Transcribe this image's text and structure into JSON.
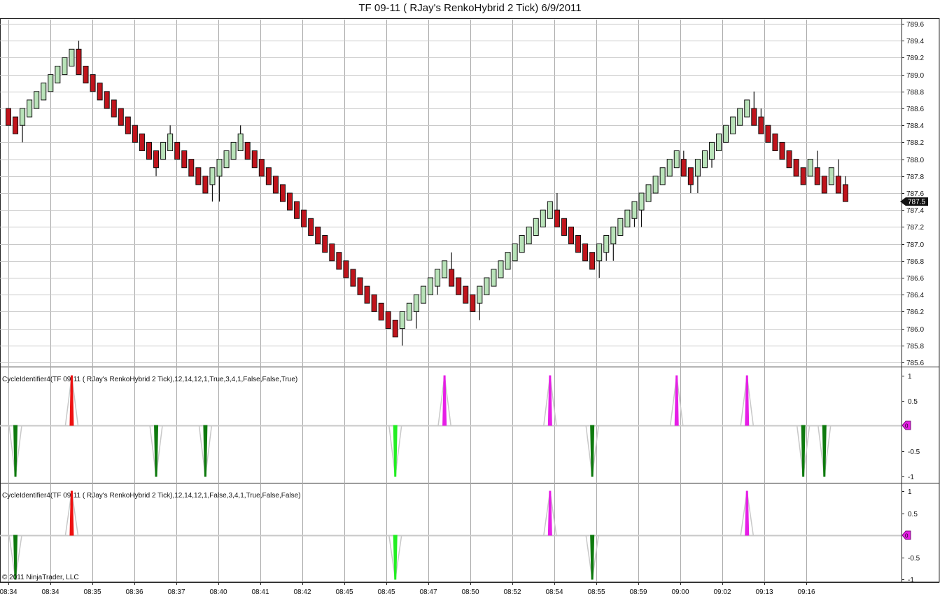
{
  "window": {
    "title": "TF 09-11 ( RJay's RenkoHybrid  2 Tick)  6/9/2011"
  },
  "colors": {
    "up_fill": "#b9e3b9",
    "down_fill": "#c0141c",
    "grid": "#c8c8c8",
    "vgrid": "#a8a8a8",
    "cycle_up": "#ee1111",
    "cycle_up_alt": "#e61ee6",
    "cycle_down": "#0e7a0e",
    "cycle_down_alt": "#22ee22",
    "envelope": "#c8c8c8",
    "zero_badge": "#e61ee6"
  },
  "chart_data": [
    {
      "type": "candlestick",
      "title": "TF 09-11 ( RJay's RenkoHybrid  2 Tick)  6/9/2011",
      "ylim": [
        785.5,
        789.65
      ],
      "y_ticks": [
        "789.6",
        "789.4",
        "789.2",
        "789.0",
        "788.8",
        "788.6",
        "788.4",
        "788.2",
        "788.0",
        "787.8",
        "787.6",
        "787.4",
        "787.2",
        "787.0",
        "786.8",
        "786.6",
        "786.4",
        "786.2",
        "786.0",
        "785.8",
        "785.6"
      ],
      "x_ticks": [
        "08:34",
        "08:34",
        "08:35",
        "08:36",
        "08:37",
        "08:40",
        "08:41",
        "08:42",
        "08:45",
        "08:45",
        "08:47",
        "08:50",
        "08:52",
        "08:54",
        "08:55",
        "08:59",
        "09:00",
        "09:02",
        "09:13",
        "09:16"
      ],
      "last_price": "787.5",
      "bricks": [
        {
          "d": -1,
          "o": 788.6,
          "c": 788.4,
          "lo": 788.4,
          "hi": 788.6
        },
        {
          "d": -1,
          "o": 788.5,
          "c": 788.3,
          "lo": 788.3,
          "hi": 788.5
        },
        {
          "d": 1,
          "o": 788.4,
          "c": 788.6,
          "lo": 788.2,
          "hi": 788.6
        },
        {
          "d": 1,
          "o": 788.5,
          "c": 788.7,
          "lo": 788.5,
          "hi": 788.7
        },
        {
          "d": 1,
          "o": 788.6,
          "c": 788.8,
          "lo": 788.6,
          "hi": 788.8
        },
        {
          "d": 1,
          "o": 788.7,
          "c": 788.9,
          "lo": 788.7,
          "hi": 788.9
        },
        {
          "d": 1,
          "o": 788.8,
          "c": 789.0,
          "lo": 788.8,
          "hi": 789.0
        },
        {
          "d": 1,
          "o": 788.9,
          "c": 789.1,
          "lo": 788.9,
          "hi": 789.1
        },
        {
          "d": 1,
          "o": 789.0,
          "c": 789.2,
          "lo": 789.0,
          "hi": 789.2
        },
        {
          "d": 1,
          "o": 789.1,
          "c": 789.3,
          "lo": 789.1,
          "hi": 789.3
        },
        {
          "d": -1,
          "o": 789.3,
          "c": 789.0,
          "lo": 789.0,
          "hi": 789.4
        },
        {
          "d": -1,
          "o": 789.1,
          "c": 788.9,
          "lo": 788.9,
          "hi": 789.1
        },
        {
          "d": -1,
          "o": 789.0,
          "c": 788.8,
          "lo": 788.8,
          "hi": 789.0
        },
        {
          "d": -1,
          "o": 788.9,
          "c": 788.7,
          "lo": 788.7,
          "hi": 788.9
        },
        {
          "d": -1,
          "o": 788.8,
          "c": 788.6,
          "lo": 788.6,
          "hi": 788.8
        },
        {
          "d": -1,
          "o": 788.7,
          "c": 788.5,
          "lo": 788.5,
          "hi": 788.7
        },
        {
          "d": -1,
          "o": 788.6,
          "c": 788.4,
          "lo": 788.4,
          "hi": 788.6
        },
        {
          "d": -1,
          "o": 788.5,
          "c": 788.3,
          "lo": 788.3,
          "hi": 788.5
        },
        {
          "d": -1,
          "o": 788.4,
          "c": 788.2,
          "lo": 788.2,
          "hi": 788.4
        },
        {
          "d": -1,
          "o": 788.3,
          "c": 788.1,
          "lo": 788.1,
          "hi": 788.3
        },
        {
          "d": -1,
          "o": 788.2,
          "c": 788.0,
          "lo": 788.0,
          "hi": 788.2
        },
        {
          "d": -1,
          "o": 788.1,
          "c": 787.9,
          "lo": 787.8,
          "hi": 788.1
        },
        {
          "d": 1,
          "o": 788.0,
          "c": 788.2,
          "lo": 788.0,
          "hi": 788.2
        },
        {
          "d": 1,
          "o": 788.1,
          "c": 788.3,
          "lo": 788.1,
          "hi": 788.4
        },
        {
          "d": -1,
          "o": 788.2,
          "c": 788.0,
          "lo": 788.0,
          "hi": 788.2
        },
        {
          "d": -1,
          "o": 788.1,
          "c": 787.9,
          "lo": 787.9,
          "hi": 788.1
        },
        {
          "d": -1,
          "o": 788.0,
          "c": 787.8,
          "lo": 787.8,
          "hi": 788.0
        },
        {
          "d": -1,
          "o": 787.9,
          "c": 787.7,
          "lo": 787.7,
          "hi": 787.9
        },
        {
          "d": -1,
          "o": 787.8,
          "c": 787.6,
          "lo": 787.6,
          "hi": 787.8
        },
        {
          "d": 1,
          "o": 787.7,
          "c": 787.9,
          "lo": 787.5,
          "hi": 787.9
        },
        {
          "d": 1,
          "o": 787.8,
          "c": 788.0,
          "lo": 787.5,
          "hi": 788.0
        },
        {
          "d": 1,
          "o": 787.9,
          "c": 788.1,
          "lo": 787.9,
          "hi": 788.1
        },
        {
          "d": 1,
          "o": 788.0,
          "c": 788.2,
          "lo": 788.0,
          "hi": 788.2
        },
        {
          "d": 1,
          "o": 788.1,
          "c": 788.3,
          "lo": 788.1,
          "hi": 788.4
        },
        {
          "d": -1,
          "o": 788.2,
          "c": 788.0,
          "lo": 788.0,
          "hi": 788.2
        },
        {
          "d": -1,
          "o": 788.1,
          "c": 787.9,
          "lo": 787.9,
          "hi": 788.1
        },
        {
          "d": -1,
          "o": 788.0,
          "c": 787.8,
          "lo": 787.8,
          "hi": 788.0
        },
        {
          "d": -1,
          "o": 787.9,
          "c": 787.7,
          "lo": 787.7,
          "hi": 787.9
        },
        {
          "d": -1,
          "o": 787.8,
          "c": 787.6,
          "lo": 787.6,
          "hi": 787.8
        },
        {
          "d": -1,
          "o": 787.7,
          "c": 787.5,
          "lo": 787.5,
          "hi": 787.7
        },
        {
          "d": -1,
          "o": 787.6,
          "c": 787.4,
          "lo": 787.4,
          "hi": 787.6
        },
        {
          "d": -1,
          "o": 787.5,
          "c": 787.3,
          "lo": 787.3,
          "hi": 787.5
        },
        {
          "d": -1,
          "o": 787.4,
          "c": 787.2,
          "lo": 787.2,
          "hi": 787.4
        },
        {
          "d": -1,
          "o": 787.3,
          "c": 787.1,
          "lo": 787.1,
          "hi": 787.3
        },
        {
          "d": -1,
          "o": 787.2,
          "c": 787.0,
          "lo": 787.0,
          "hi": 787.2
        },
        {
          "d": -1,
          "o": 787.1,
          "c": 786.9,
          "lo": 786.9,
          "hi": 787.1
        },
        {
          "d": -1,
          "o": 787.0,
          "c": 786.8,
          "lo": 786.8,
          "hi": 787.0
        },
        {
          "d": -1,
          "o": 786.9,
          "c": 786.7,
          "lo": 786.7,
          "hi": 786.9
        },
        {
          "d": -1,
          "o": 786.8,
          "c": 786.6,
          "lo": 786.6,
          "hi": 786.8
        },
        {
          "d": -1,
          "o": 786.7,
          "c": 786.5,
          "lo": 786.5,
          "hi": 786.7
        },
        {
          "d": -1,
          "o": 786.6,
          "c": 786.4,
          "lo": 786.4,
          "hi": 786.6
        },
        {
          "d": -1,
          "o": 786.5,
          "c": 786.3,
          "lo": 786.3,
          "hi": 786.5
        },
        {
          "d": -1,
          "o": 786.4,
          "c": 786.2,
          "lo": 786.2,
          "hi": 786.4
        },
        {
          "d": -1,
          "o": 786.3,
          "c": 786.1,
          "lo": 786.1,
          "hi": 786.3
        },
        {
          "d": -1,
          "o": 786.2,
          "c": 786.0,
          "lo": 786.0,
          "hi": 786.2
        },
        {
          "d": -1,
          "o": 786.1,
          "c": 785.9,
          "lo": 785.9,
          "hi": 786.1
        },
        {
          "d": 1,
          "o": 786.0,
          "c": 786.2,
          "lo": 785.8,
          "hi": 786.2
        },
        {
          "d": 1,
          "o": 786.1,
          "c": 786.3,
          "lo": 786.1,
          "hi": 786.3
        },
        {
          "d": 1,
          "o": 786.2,
          "c": 786.4,
          "lo": 786.0,
          "hi": 786.4
        },
        {
          "d": 1,
          "o": 786.3,
          "c": 786.5,
          "lo": 786.3,
          "hi": 786.5
        },
        {
          "d": 1,
          "o": 786.4,
          "c": 786.6,
          "lo": 786.4,
          "hi": 786.6
        },
        {
          "d": 1,
          "o": 786.5,
          "c": 786.7,
          "lo": 786.4,
          "hi": 786.7
        },
        {
          "d": 1,
          "o": 786.6,
          "c": 786.8,
          "lo": 786.6,
          "hi": 786.8
        },
        {
          "d": -1,
          "o": 786.7,
          "c": 786.5,
          "lo": 786.5,
          "hi": 786.9
        },
        {
          "d": -1,
          "o": 786.6,
          "c": 786.4,
          "lo": 786.4,
          "hi": 786.6
        },
        {
          "d": -1,
          "o": 786.5,
          "c": 786.3,
          "lo": 786.3,
          "hi": 786.5
        },
        {
          "d": -1,
          "o": 786.4,
          "c": 786.2,
          "lo": 786.2,
          "hi": 786.4
        },
        {
          "d": 1,
          "o": 786.3,
          "c": 786.5,
          "lo": 786.1,
          "hi": 786.5
        },
        {
          "d": 1,
          "o": 786.4,
          "c": 786.6,
          "lo": 786.4,
          "hi": 786.6
        },
        {
          "d": 1,
          "o": 786.5,
          "c": 786.7,
          "lo": 786.5,
          "hi": 786.7
        },
        {
          "d": 1,
          "o": 786.6,
          "c": 786.8,
          "lo": 786.6,
          "hi": 786.8
        },
        {
          "d": 1,
          "o": 786.7,
          "c": 786.9,
          "lo": 786.7,
          "hi": 786.9
        },
        {
          "d": 1,
          "o": 786.8,
          "c": 787.0,
          "lo": 786.8,
          "hi": 787.0
        },
        {
          "d": 1,
          "o": 786.9,
          "c": 787.1,
          "lo": 786.9,
          "hi": 787.1
        },
        {
          "d": 1,
          "o": 787.0,
          "c": 787.2,
          "lo": 787.0,
          "hi": 787.2
        },
        {
          "d": 1,
          "o": 787.1,
          "c": 787.3,
          "lo": 787.1,
          "hi": 787.3
        },
        {
          "d": 1,
          "o": 787.2,
          "c": 787.4,
          "lo": 787.2,
          "hi": 787.4
        },
        {
          "d": 1,
          "o": 787.3,
          "c": 787.5,
          "lo": 787.3,
          "hi": 787.5
        },
        {
          "d": -1,
          "o": 787.4,
          "c": 787.2,
          "lo": 787.2,
          "hi": 787.6
        },
        {
          "d": -1,
          "o": 787.3,
          "c": 787.1,
          "lo": 787.1,
          "hi": 787.3
        },
        {
          "d": -1,
          "o": 787.2,
          "c": 787.0,
          "lo": 787.0,
          "hi": 787.2
        },
        {
          "d": -1,
          "o": 787.1,
          "c": 786.9,
          "lo": 786.9,
          "hi": 787.1
        },
        {
          "d": -1,
          "o": 787.0,
          "c": 786.8,
          "lo": 786.8,
          "hi": 787.0
        },
        {
          "d": -1,
          "o": 786.9,
          "c": 786.7,
          "lo": 786.7,
          "hi": 786.9
        },
        {
          "d": 1,
          "o": 786.8,
          "c": 787.0,
          "lo": 786.6,
          "hi": 787.0
        },
        {
          "d": 1,
          "o": 786.9,
          "c": 787.1,
          "lo": 786.8,
          "hi": 787.1
        },
        {
          "d": 1,
          "o": 787.0,
          "c": 787.2,
          "lo": 786.8,
          "hi": 787.2
        },
        {
          "d": 1,
          "o": 787.1,
          "c": 787.3,
          "lo": 787.1,
          "hi": 787.3
        },
        {
          "d": 1,
          "o": 787.2,
          "c": 787.4,
          "lo": 787.2,
          "hi": 787.4
        },
        {
          "d": 1,
          "o": 787.3,
          "c": 787.5,
          "lo": 787.2,
          "hi": 787.5
        },
        {
          "d": 1,
          "o": 787.4,
          "c": 787.6,
          "lo": 787.2,
          "hi": 787.6
        },
        {
          "d": 1,
          "o": 787.5,
          "c": 787.7,
          "lo": 787.5,
          "hi": 787.7
        },
        {
          "d": 1,
          "o": 787.6,
          "c": 787.8,
          "lo": 787.6,
          "hi": 787.8
        },
        {
          "d": 1,
          "o": 787.7,
          "c": 787.9,
          "lo": 787.7,
          "hi": 787.9
        },
        {
          "d": 1,
          "o": 787.8,
          "c": 788.0,
          "lo": 787.8,
          "hi": 788.0
        },
        {
          "d": 1,
          "o": 787.9,
          "c": 788.1,
          "lo": 787.9,
          "hi": 788.1
        },
        {
          "d": -1,
          "o": 788.0,
          "c": 787.8,
          "lo": 787.8,
          "hi": 788.1
        },
        {
          "d": -1,
          "o": 787.9,
          "c": 787.7,
          "lo": 787.6,
          "hi": 787.9
        },
        {
          "d": 1,
          "o": 787.8,
          "c": 788.0,
          "lo": 787.6,
          "hi": 788.0
        },
        {
          "d": 1,
          "o": 787.9,
          "c": 788.1,
          "lo": 787.9,
          "hi": 788.1
        },
        {
          "d": 1,
          "o": 788.0,
          "c": 788.2,
          "lo": 787.9,
          "hi": 788.2
        },
        {
          "d": 1,
          "o": 788.1,
          "c": 788.3,
          "lo": 788.1,
          "hi": 788.3
        },
        {
          "d": 1,
          "o": 788.2,
          "c": 788.4,
          "lo": 788.2,
          "hi": 788.4
        },
        {
          "d": 1,
          "o": 788.3,
          "c": 788.5,
          "lo": 788.3,
          "hi": 788.5
        },
        {
          "d": 1,
          "o": 788.4,
          "c": 788.6,
          "lo": 788.4,
          "hi": 788.6
        },
        {
          "d": 1,
          "o": 788.5,
          "c": 788.7,
          "lo": 788.5,
          "hi": 788.7
        },
        {
          "d": -1,
          "o": 788.6,
          "c": 788.4,
          "lo": 788.4,
          "hi": 788.8
        },
        {
          "d": -1,
          "o": 788.5,
          "c": 788.3,
          "lo": 788.3,
          "hi": 788.6
        },
        {
          "d": -1,
          "o": 788.4,
          "c": 788.2,
          "lo": 788.2,
          "hi": 788.4
        },
        {
          "d": -1,
          "o": 788.3,
          "c": 788.1,
          "lo": 788.1,
          "hi": 788.3
        },
        {
          "d": -1,
          "o": 788.2,
          "c": 788.0,
          "lo": 788.0,
          "hi": 788.2
        },
        {
          "d": -1,
          "o": 788.1,
          "c": 787.9,
          "lo": 787.9,
          "hi": 788.1
        },
        {
          "d": -1,
          "o": 788.0,
          "c": 787.8,
          "lo": 787.8,
          "hi": 788.0
        },
        {
          "d": -1,
          "o": 787.9,
          "c": 787.7,
          "lo": 787.7,
          "hi": 787.9
        },
        {
          "d": 1,
          "o": 787.8,
          "c": 788.0,
          "lo": 787.8,
          "hi": 788.0
        },
        {
          "d": -1,
          "o": 787.9,
          "c": 787.7,
          "lo": 787.7,
          "hi": 788.1
        },
        {
          "d": -1,
          "o": 787.8,
          "c": 787.6,
          "lo": 787.6,
          "hi": 787.8
        },
        {
          "d": 1,
          "o": 787.7,
          "c": 787.9,
          "lo": 787.7,
          "hi": 787.9
        },
        {
          "d": -1,
          "o": 787.8,
          "c": 787.6,
          "lo": 787.6,
          "hi": 788.0
        },
        {
          "d": -1,
          "o": 787.7,
          "c": 787.5,
          "lo": 787.5,
          "hi": 787.8
        }
      ]
    },
    {
      "type": "bar",
      "title": "CycleIdentifier4(TF 09-11 ( RJay's RenkoHybrid  2 Tick),12,14,12,1,True,3,4,1,False,False,True)",
      "ylim": [
        -1.1,
        1.1
      ],
      "y_ticks": [
        "1",
        "0.5",
        "0",
        "-0.5",
        "-1"
      ],
      "zero_label": "0",
      "signals": [
        {
          "bar": 1,
          "value": -1,
          "color": "cycle_down"
        },
        {
          "bar": 9,
          "value": 1,
          "color": "cycle_up"
        },
        {
          "bar": 21,
          "value": -1,
          "color": "cycle_down"
        },
        {
          "bar": 28,
          "value": -1,
          "color": "cycle_down"
        },
        {
          "bar": 55,
          "value": -1,
          "color": "cycle_down_alt"
        },
        {
          "bar": 62,
          "value": 1,
          "color": "cycle_up_alt"
        },
        {
          "bar": 77,
          "value": 1,
          "color": "cycle_up_alt"
        },
        {
          "bar": 83,
          "value": -1,
          "color": "cycle_down"
        },
        {
          "bar": 95,
          "value": 1,
          "color": "cycle_up_alt"
        },
        {
          "bar": 105,
          "value": 1,
          "color": "cycle_up_alt"
        },
        {
          "bar": 113,
          "value": -1,
          "color": "cycle_down"
        },
        {
          "bar": 116,
          "value": -1,
          "color": "cycle_down"
        }
      ]
    },
    {
      "type": "bar",
      "title": "CycleIdentifier4(TF 09-11 ( RJay's RenkoHybrid  2 Tick),12,14,12,1,False,3,4,1,True,False,False)",
      "ylim": [
        -1.1,
        1.1
      ],
      "y_ticks": [
        "1",
        "0.5",
        "0",
        "-0.5",
        "-1"
      ],
      "zero_label": "0",
      "signals": [
        {
          "bar": 1,
          "value": -1,
          "color": "cycle_down"
        },
        {
          "bar": 9,
          "value": 1,
          "color": "cycle_up"
        },
        {
          "bar": 55,
          "value": -1,
          "color": "cycle_down_alt"
        },
        {
          "bar": 77,
          "value": 1,
          "color": "cycle_up_alt"
        },
        {
          "bar": 83,
          "value": -1,
          "color": "cycle_down"
        },
        {
          "bar": 105,
          "value": 1,
          "color": "cycle_up_alt"
        }
      ]
    }
  ],
  "footer": {
    "copyright": "© 2011 NinjaTrader, LLC"
  }
}
